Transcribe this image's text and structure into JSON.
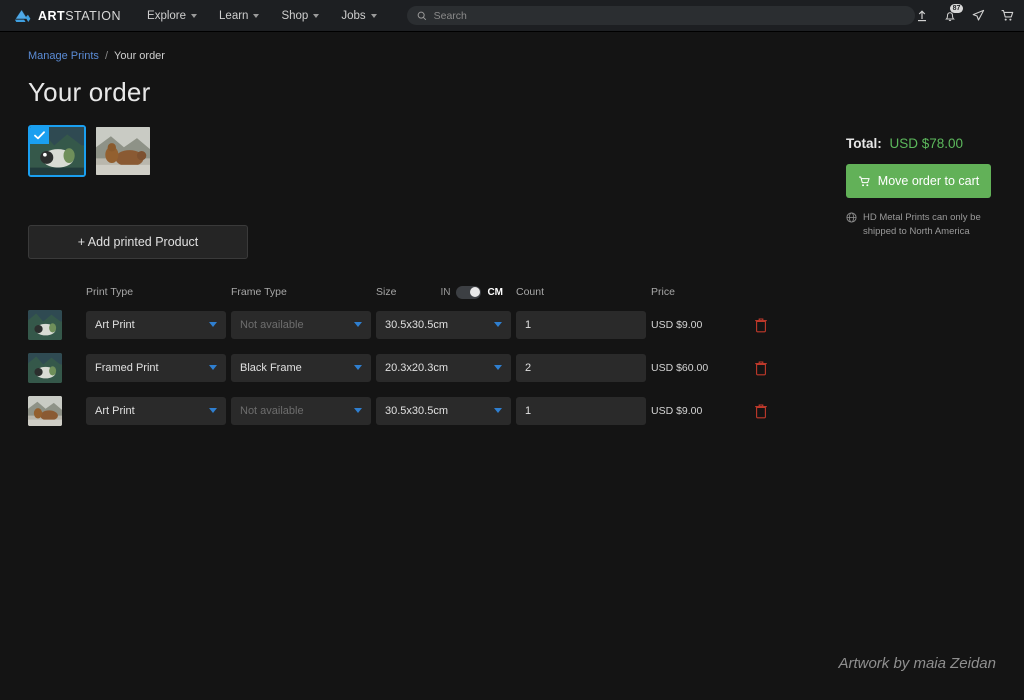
{
  "header": {
    "logo": {
      "bold": "ART",
      "light": "STATION"
    },
    "nav": [
      {
        "label": "Explore"
      },
      {
        "label": "Learn"
      },
      {
        "label": "Shop"
      },
      {
        "label": "Jobs"
      }
    ],
    "search": {
      "placeholder": "Search",
      "value": ""
    },
    "notifications_badge": "87",
    "icons": [
      "upload-icon",
      "bell-icon",
      "messages-icon",
      "cart-icon",
      "avatar",
      "kebab-menu-icon"
    ]
  },
  "breadcrumb": {
    "parent": "Manage Prints",
    "separator": "/",
    "current": "Your order"
  },
  "page_title": "Your order",
  "thumbnails": [
    {
      "name": "panda-artwork",
      "selected": true
    },
    {
      "name": "bears-artwork",
      "selected": false
    }
  ],
  "summary": {
    "total_label": "Total:",
    "total_value": "USD $78.00",
    "total_color": "#5cb85c",
    "cart_button": "Move order to cart",
    "cart_button_color": "#62b158",
    "shipping_note": "HD Metal Prints can only be shipped to North America"
  },
  "add_product_button": "+ Add printed Product",
  "table": {
    "headers": {
      "print_type": "Print Type",
      "frame_type": "Frame Type",
      "size": "Size",
      "count": "Count",
      "price": "Price"
    },
    "unit_toggle": {
      "left": "IN",
      "right": "CM",
      "active": "CM"
    },
    "rows": [
      {
        "thumb": "panda-artwork",
        "print_type": "Art Print",
        "frame_type": "Not available",
        "frame_disabled": true,
        "size": "30.5x30.5cm",
        "count": "1",
        "price": "USD $9.00"
      },
      {
        "thumb": "panda-artwork",
        "print_type": "Framed Print",
        "frame_type": "Black Frame",
        "frame_disabled": false,
        "size": "20.3x20.3cm",
        "count": "2",
        "price": "USD $60.00"
      },
      {
        "thumb": "bears-artwork",
        "print_type": "Art Print",
        "frame_type": "Not available",
        "frame_disabled": true,
        "size": "30.5x30.5cm",
        "count": "1",
        "price": "USD $9.00"
      }
    ]
  },
  "credit": "Artwork by maia Zeidan"
}
